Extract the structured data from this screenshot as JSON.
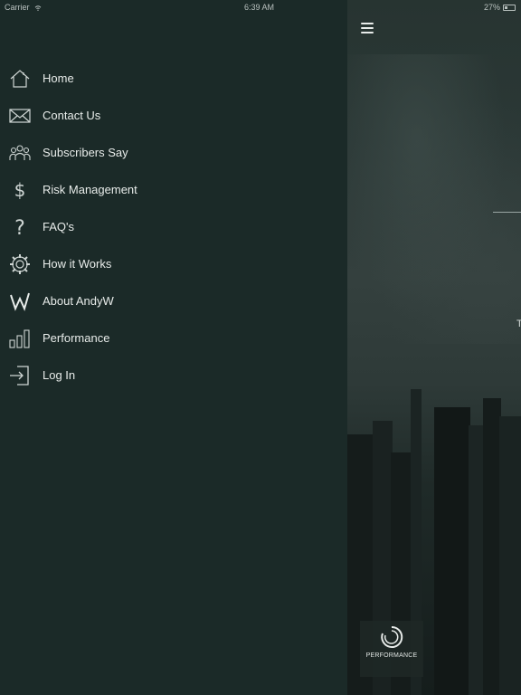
{
  "status": {
    "carrier": "Carrier",
    "time": "6:39 AM",
    "battery": "27%"
  },
  "menu": {
    "items": [
      {
        "label": "Home",
        "icon": "home-icon"
      },
      {
        "label": "Contact Us",
        "icon": "envelope-icon"
      },
      {
        "label": "Subscribers Say",
        "icon": "users-icon"
      },
      {
        "label": "Risk Management",
        "icon": "dollar-icon"
      },
      {
        "label": "FAQ's",
        "icon": "question-icon"
      },
      {
        "label": "How it Works",
        "icon": "gear-icon"
      },
      {
        "label": "About AndyW",
        "icon": "w-logo-icon"
      },
      {
        "label": "Performance",
        "icon": "bar-chart-icon"
      },
      {
        "label": "Log In",
        "icon": "login-icon"
      }
    ]
  },
  "content": {
    "edge_text": "T",
    "tab": {
      "label": "PERFORMANCE",
      "icon": "spinner-icon"
    }
  },
  "colors": {
    "drawer_bg": "#1b2a28",
    "text": "#e8ecea"
  }
}
